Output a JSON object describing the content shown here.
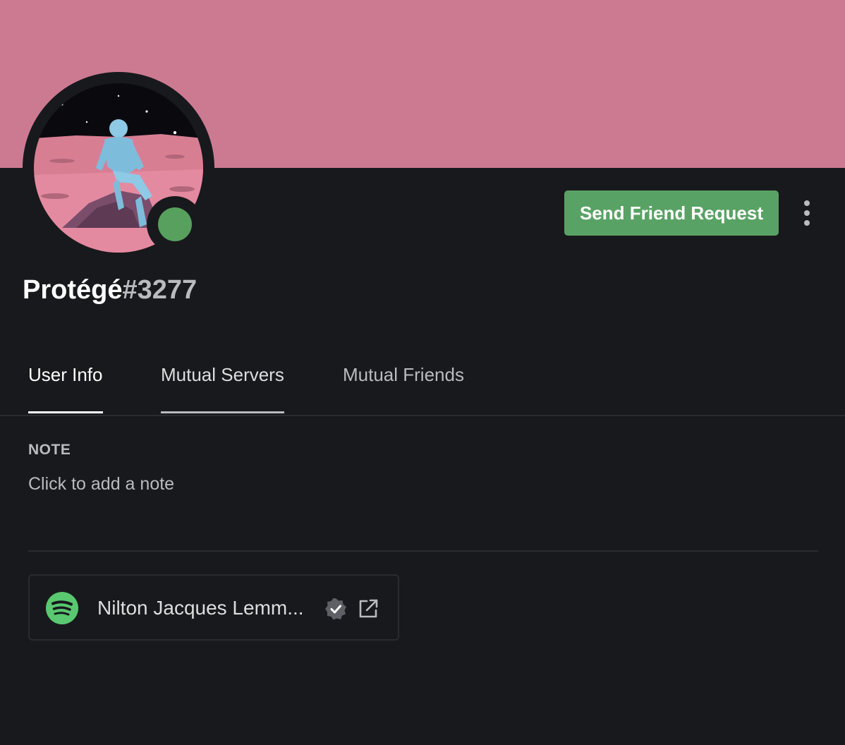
{
  "colors": {
    "banner": "#cc7a92",
    "background": "#18191c",
    "status_online": "#57a05e",
    "send_button": "#59a265",
    "spotify_green": "#59c870",
    "tab_active_underline": "#ffffff",
    "tab_hover_underline": "#b9bbbe"
  },
  "avatar": {
    "icon": "user-avatar-image",
    "status": "online"
  },
  "actions": {
    "send_friend_request_label": "Send Friend Request",
    "more_icon": "more-vertical-icon"
  },
  "user": {
    "username": "Protégé",
    "discriminator": "#3277"
  },
  "tabs": [
    {
      "label": "User Info",
      "active": true
    },
    {
      "label": "Mutual Servers",
      "active": false
    },
    {
      "label": "Mutual Friends",
      "active": false
    }
  ],
  "note": {
    "header": "NOTE",
    "placeholder": "Click to add a note"
  },
  "connection": {
    "service_icon": "spotify-icon",
    "name": "Nilton Jacques Lemm...",
    "verified_icon": "verified-badge-icon",
    "link_icon": "external-link-icon"
  }
}
